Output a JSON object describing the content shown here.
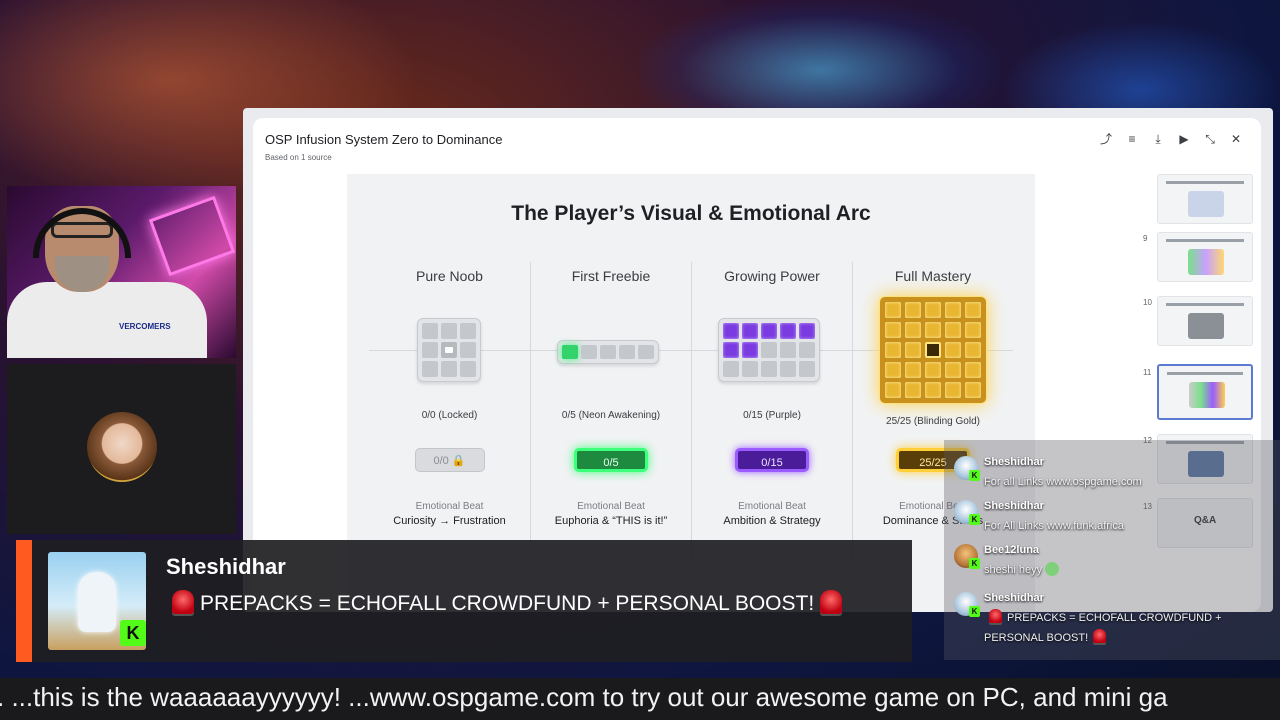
{
  "notebook": {
    "title": "OSP Infusion System Zero to Dominance",
    "source_note": "Based on 1 source",
    "toolbar": [
      "share-icon",
      "edit-icon",
      "download-icon",
      "play-icon",
      "collapse-icon",
      "close-icon"
    ]
  },
  "slide": {
    "title": "The Player’s Visual & Emotional Arc",
    "beat_label": "Emotional Beat",
    "stages": [
      {
        "name": "Pure Noob",
        "caption": "0/0 (Locked)",
        "pill": "0/0",
        "beat": "Curiosity → Frustration",
        "color": "#c4c7cc"
      },
      {
        "name": "First Freebie",
        "caption": "0/5 (Neon Awakening)",
        "pill": "0/5",
        "beat": "Euphoria & “THIS is it!”",
        "color": "#33d26a"
      },
      {
        "name": "Growing Power",
        "caption": "0/15 (Purple)",
        "pill": "0/15",
        "beat": "Ambition & Strategy",
        "color": "#7a3be0"
      },
      {
        "name": "Full Mastery",
        "caption": "25/25 (Blinding Gold)",
        "pill": "25/25",
        "beat": "Dominance & Status",
        "color": "#e9b632"
      }
    ]
  },
  "thumbnails": [
    {
      "num": "",
      "active": false
    },
    {
      "num": "9",
      "active": false
    },
    {
      "num": "10",
      "active": false
    },
    {
      "num": "11",
      "active": true
    },
    {
      "num": "12",
      "active": false
    },
    {
      "num": "13",
      "active": false,
      "label": "Q&A"
    }
  ],
  "alert": {
    "name": "Sheshidhar",
    "message": "PREPACKS = ECHOFALL CROWDFUND + PERSONAL BOOST!",
    "accent": "#ff5a1f"
  },
  "chat": [
    {
      "user": "Sheshidhar",
      "text": "For all Links www.ospgame.com"
    },
    {
      "user": "Sheshidhar",
      "text": "For All Links www.funk.africa"
    },
    {
      "user": "Bee12luna",
      "text": "sheshi heyy"
    },
    {
      "user": "Sheshidhar",
      "text_line1": "PREPACKS = ECHOFALL CROWDFUND +",
      "text_line2": "PERSONAL BOOST!"
    }
  ],
  "ticker": {
    "text": ". ...this is the waaaaaayyyyyy! ...www.ospgame.com to try out our awesome game on PC, and mini ga"
  },
  "webcam": {
    "logo_text": "VERCOMERS"
  }
}
